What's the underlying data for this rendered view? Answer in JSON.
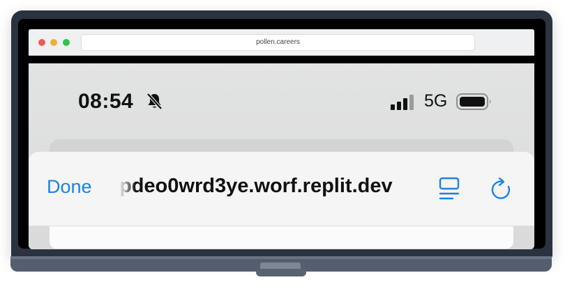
{
  "browser": {
    "address": "pollen.careers"
  },
  "status_bar": {
    "time": "08:54",
    "network": "5G",
    "icons": [
      "bell-slash-icon",
      "signal-icon",
      "battery-icon"
    ]
  },
  "sheet": {
    "done_label": "Done",
    "url": "pdeo0wrd3ye.worf.replit.dev",
    "icons": [
      "reader-icon",
      "reload-icon"
    ]
  },
  "colors": {
    "accent": "#1a82e4",
    "laptop_body": "#2b3240"
  }
}
